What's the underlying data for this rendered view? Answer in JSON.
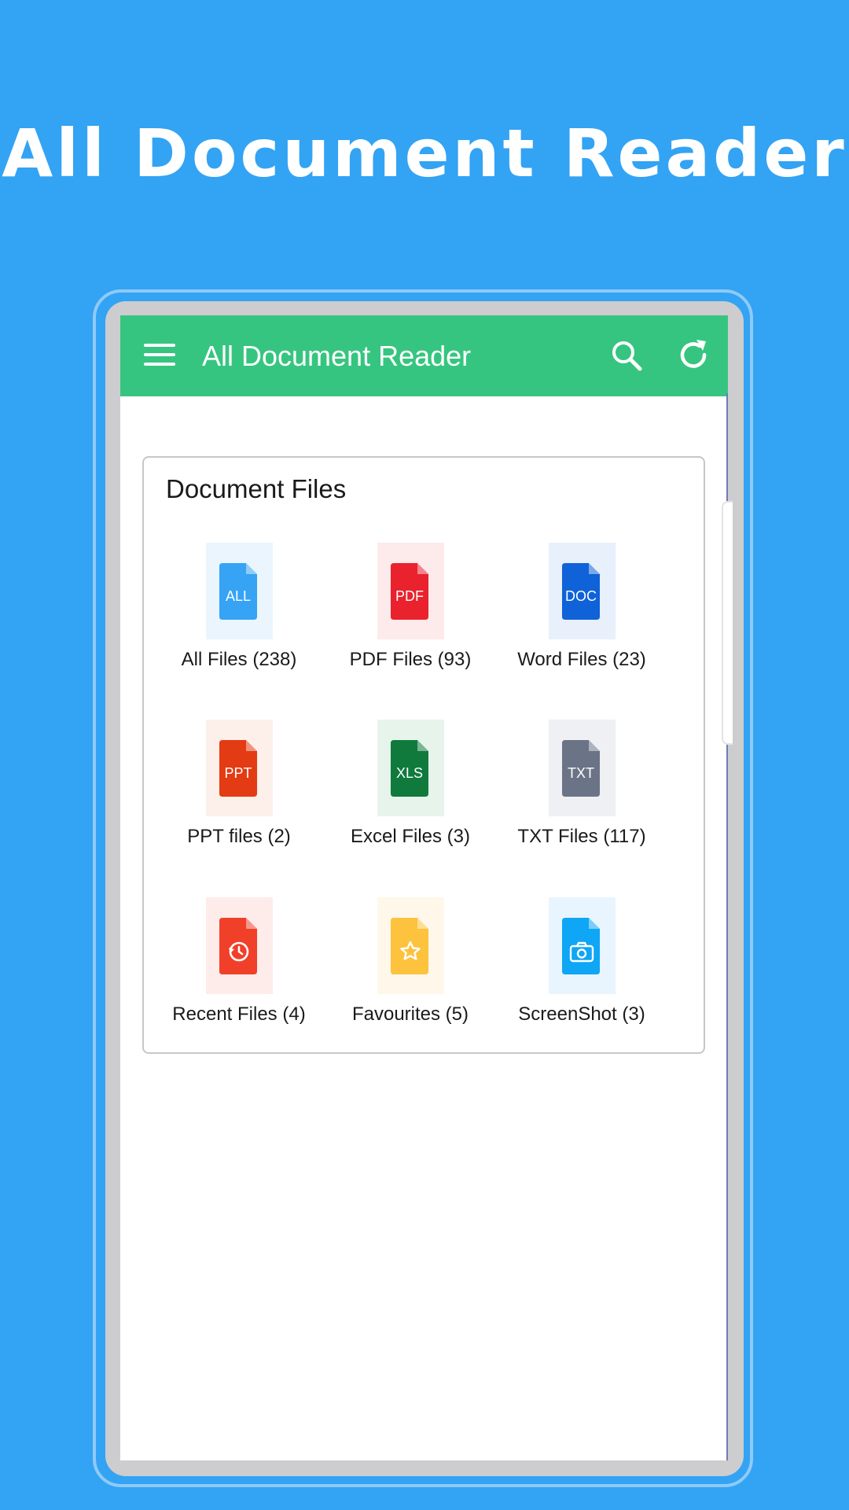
{
  "promo": {
    "headline": "All Document Reader"
  },
  "appbar": {
    "title": "All Document Reader",
    "menu_icon": "hamburger-menu-icon",
    "search_icon": "search-icon",
    "refresh_icon": "refresh-icon",
    "color": "#36c580"
  },
  "document_files": {
    "title": "Document Files",
    "tiles": [
      {
        "label": "All Files (238)",
        "icon_text": "ALL",
        "icon": "all-files-icon",
        "color": "#36a3f5",
        "tint": "#eaf5fe"
      },
      {
        "label": "PDF Files (93)",
        "icon_text": "PDF",
        "icon": "pdf-file-icon",
        "color": "#e9222d",
        "tint": "#fdeaea"
      },
      {
        "label": "Word Files (23)",
        "icon_text": "DOC",
        "icon": "word-file-icon",
        "color": "#0f62d8",
        "tint": "#e8f0fc"
      },
      {
        "label": "PPT files (2)",
        "icon_text": "PPT",
        "icon": "ppt-file-icon",
        "color": "#e33b13",
        "tint": "#fdefea"
      },
      {
        "label": "Excel Files (3)",
        "icon_text": "XLS",
        "icon": "excel-file-icon",
        "color": "#0f7a3c",
        "tint": "#e7f4ec"
      },
      {
        "label": "TXT Files (117)",
        "icon_text": "TXT",
        "icon": "txt-file-icon",
        "color": "#6b7487",
        "tint": "#eff0f3"
      },
      {
        "label": "Recent Files (4)",
        "icon_text": "",
        "icon": "recent-history-icon",
        "color": "#f0402a",
        "tint": "#fdecea"
      },
      {
        "label": "Favourites (5)",
        "icon_text": "",
        "icon": "favourite-star-icon",
        "color": "#fdc23e",
        "tint": "#fff8ea"
      },
      {
        "label": "ScreenShot (3)",
        "icon_text": "",
        "icon": "screenshot-camera-icon",
        "color": "#0ea6f5",
        "tint": "#e8f5fe"
      }
    ]
  }
}
